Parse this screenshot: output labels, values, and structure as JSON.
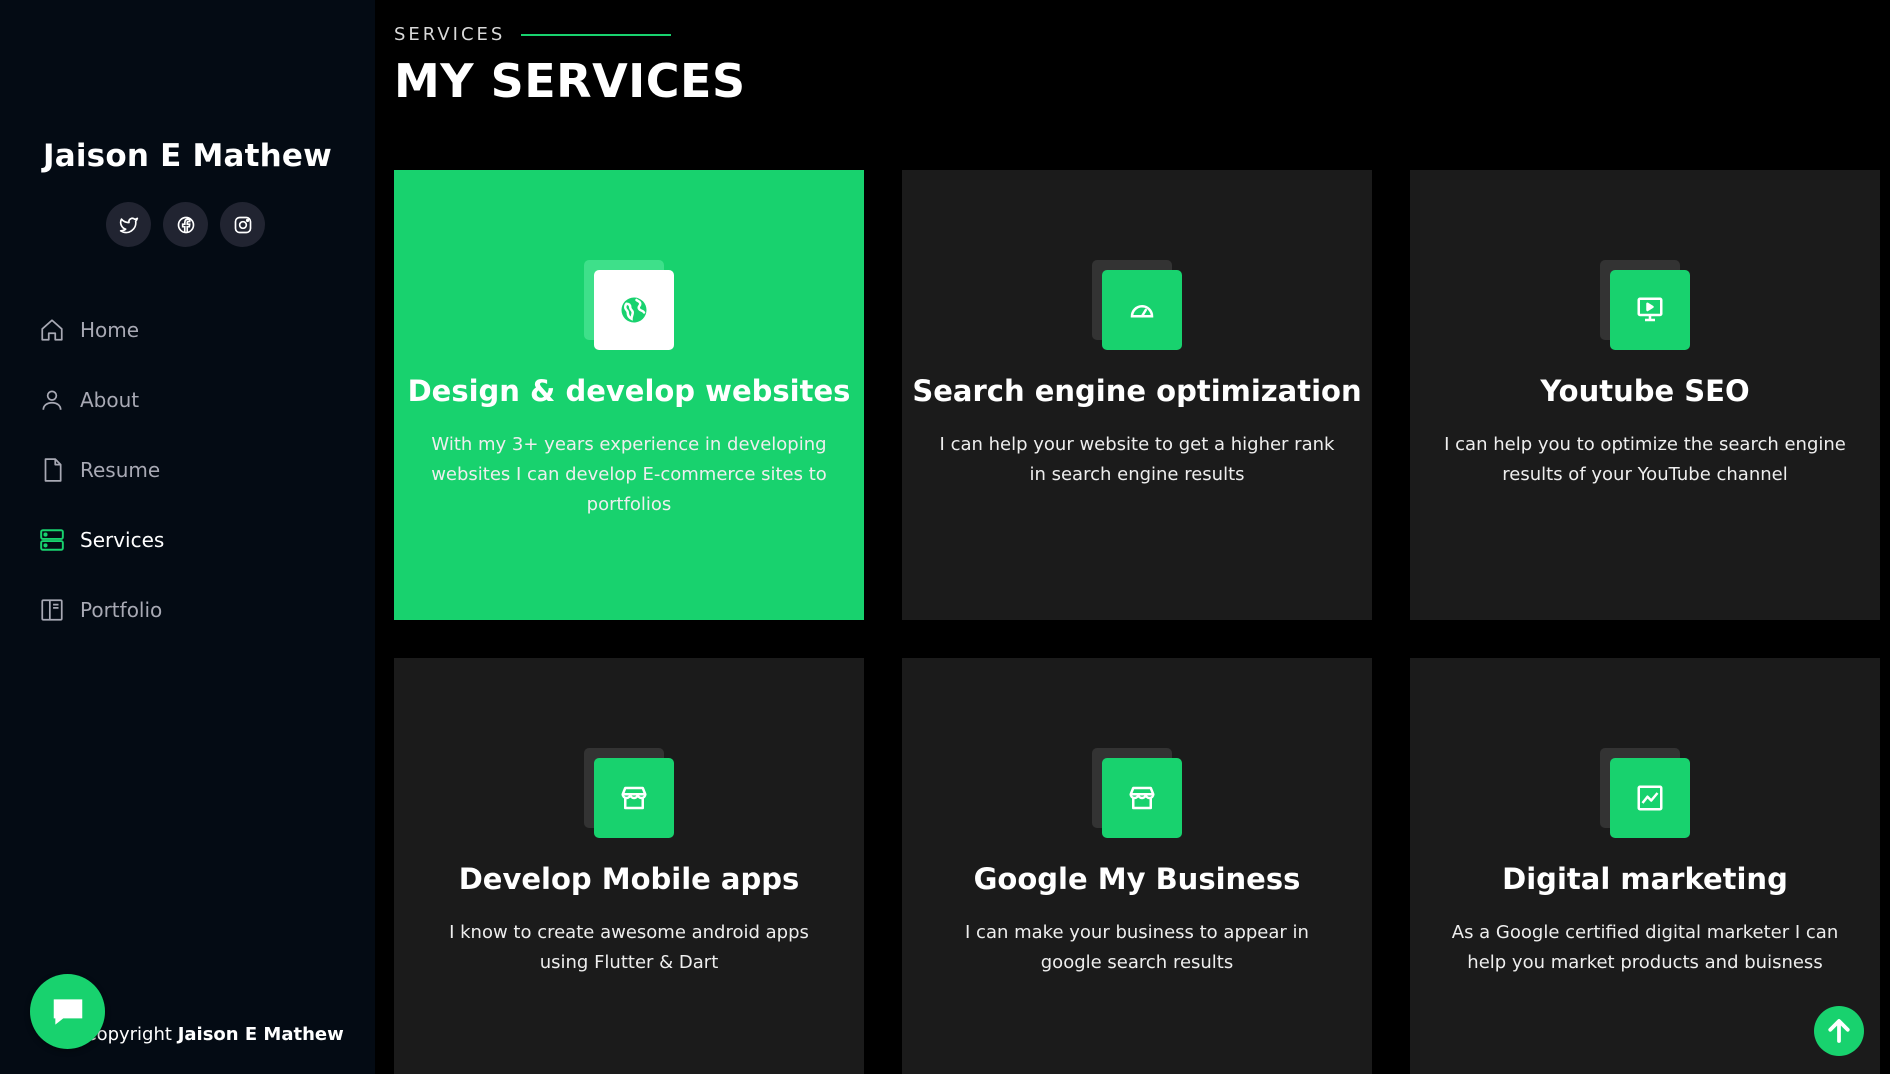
{
  "sidebar": {
    "name": "Jaison E Mathew",
    "social": [
      {
        "icon": "twitter-icon"
      },
      {
        "icon": "facebook-icon"
      },
      {
        "icon": "instagram-icon"
      }
    ],
    "nav": [
      {
        "label": "Home",
        "icon": "home-icon"
      },
      {
        "label": "About",
        "icon": "person-icon"
      },
      {
        "label": "Resume",
        "icon": "file-icon"
      },
      {
        "label": "Services",
        "icon": "server-icon",
        "active": true
      },
      {
        "label": "Portfolio",
        "icon": "book-icon"
      }
    ],
    "copyright_prefix": "Copyright ",
    "copyright_name": "Jaison E Mathew"
  },
  "main": {
    "section_label": "SERVICES",
    "title": "MY SERVICES",
    "services": [
      {
        "title": "Design & develop websites",
        "desc": "With my 3+ years experience in developing websites I can develop E-commerce sites to portfolios",
        "icon": "globe-icon"
      },
      {
        "title": "Search engine optimization",
        "desc": "I can help your website to get a higher rank in search engine results",
        "icon": "speedometer-icon"
      },
      {
        "title": "Youtube SEO",
        "desc": "I can help you to optimize the search engine results of your YouTube channel",
        "icon": "display-icon"
      },
      {
        "title": "Develop Mobile apps",
        "desc": "I know to create awesome android apps using Flutter & Dart",
        "icon": "shop-icon"
      },
      {
        "title": "Google My Business",
        "desc": "I can make your business to appear in google search results",
        "icon": "shop-icon"
      },
      {
        "title": "Digital marketing",
        "desc": "As a Google certified digital marketer I can help you market products and buisness",
        "icon": "graph-icon"
      }
    ]
  },
  "colors": {
    "accent": "#18d26e",
    "sidebar_bg": "#040b14",
    "card_bg": "#1b1b1b"
  }
}
